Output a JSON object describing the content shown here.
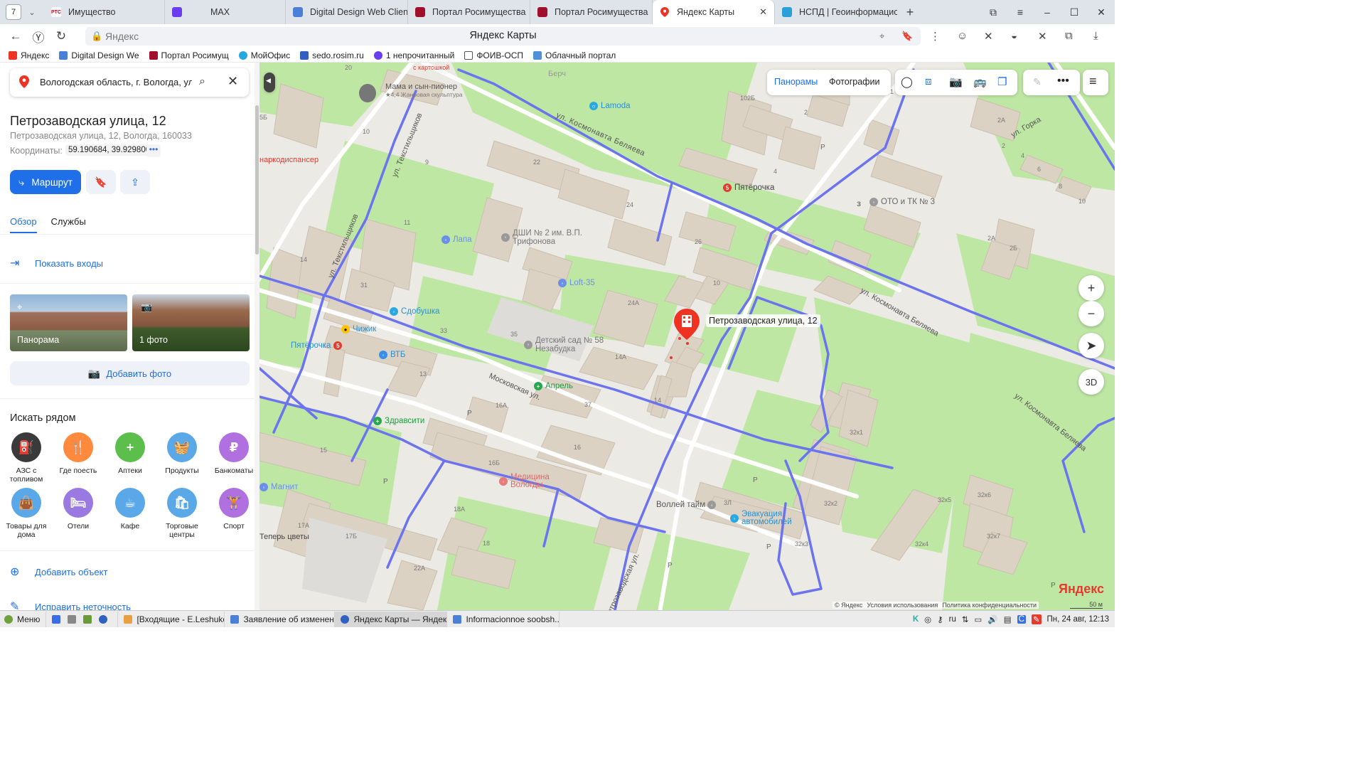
{
  "browser": {
    "tab_count": "7",
    "tabs": [
      {
        "label": "Имущество",
        "favicon_text": "РТС",
        "color": "#d0021b"
      },
      {
        "label": "MAX",
        "favicon_text": "",
        "color": "#6a3df0"
      },
      {
        "label": "Digital Design Web Client",
        "favicon_text": "",
        "color": "#4a80d8"
      },
      {
        "label": "Портал Росимущества",
        "favicon_text": "",
        "color": "#a0102c"
      },
      {
        "label": "Портал Росимущества",
        "favicon_text": "",
        "color": "#a0102c"
      },
      {
        "label": "Яндекс Карты",
        "favicon_text": "",
        "color": "#ee3323",
        "active": true
      },
      {
        "label": "НСПД | Геоинформацион",
        "favicon_text": "",
        "color": "#2aa0d8"
      }
    ],
    "close_glyph": "✕",
    "new_tab_glyph": "+",
    "address": {
      "site": "Яндекс",
      "title": "Яндекс Карты"
    },
    "bookmarks": [
      {
        "label": "Яндекс",
        "color": "#ee3323"
      },
      {
        "label": "Digital Design We",
        "color": "#4a80d8"
      },
      {
        "label": "Портал Росимущ",
        "color": "#a0102c"
      },
      {
        "label": "МойОфис",
        "color": "#28a8e0"
      },
      {
        "label": "sedo.rosim.ru",
        "color": "#3060c0"
      },
      {
        "label": "1 непрочитанный",
        "color": "#6a3df0"
      },
      {
        "label": "ФОИВ-ОСП",
        "color": "#888888"
      },
      {
        "label": "Облачный портал",
        "color": "#5090d8"
      }
    ]
  },
  "panel": {
    "search_value": "Вологодская область, г. Вологда, ул. П",
    "title": "Петрозаводская улица, 12",
    "address": "Петрозаводская улица, 12, Вологда, 160033",
    "coords_label": "Координаты:",
    "coords_value": "59.190684, 39.929800",
    "coords_more": "•••",
    "route_label": "Маршрут",
    "tabs": [
      "Обзор",
      "Службы"
    ],
    "show_entrances": "Показать входы",
    "photo_panorama": "Панорама",
    "photo_count": "1 фото",
    "add_photo": "Добавить фото",
    "nearby_title": "Искать рядом",
    "categories": [
      {
        "label": "АЗС с топливом",
        "color": "#3a3a3a",
        "icon": "fuel-icon",
        "glyph": "⛽"
      },
      {
        "label": "Где поесть",
        "color": "#ff8a3d",
        "icon": "fork-knife-icon",
        "glyph": "🍴"
      },
      {
        "label": "Аптеки",
        "color": "#5cbf4c",
        "icon": "pharmacy-cross-icon",
        "glyph": "+"
      },
      {
        "label": "Продукты",
        "color": "#5aa8e8",
        "icon": "basket-icon",
        "glyph": "🧺"
      },
      {
        "label": "Банкоматы",
        "color": "#b070e0",
        "icon": "ruble-icon",
        "glyph": "₽"
      },
      {
        "label": "Товары для дома",
        "color": "#5aa8e8",
        "icon": "bag-icon",
        "glyph": "👜"
      },
      {
        "label": "Отели",
        "color": "#9a7ae0",
        "icon": "bed-icon",
        "glyph": "🛏"
      },
      {
        "label": "Кафе",
        "color": "#5aa8e8",
        "icon": "cup-icon",
        "glyph": "☕"
      },
      {
        "label": "Торговые центры",
        "color": "#5aa8e8",
        "icon": "shopping-bag-icon",
        "glyph": "🛍"
      },
      {
        "label": "Спорт",
        "color": "#b070e0",
        "icon": "dumbbell-icon",
        "glyph": "🏋"
      }
    ],
    "add_object": "Добавить объект",
    "fix_error": "Исправить неточность"
  },
  "map": {
    "toolbar": {
      "panoramas": "Панорамы",
      "photos": "Фотографии"
    },
    "zoom_in": "+",
    "zoom_out": "−",
    "btn_3d": "3D",
    "marker_label": "Петрозаводская улица, 12",
    "streets": [
      "ул. Космонавта Беляева",
      "ул. Текстильщиков",
      "ул. Текстильщиков",
      "Московская ул.",
      "ул. Космонавта Беляева",
      "ул. Горка",
      "ул. Космонавта Беляева",
      "Петрозаводская ул."
    ],
    "pois": [
      {
        "label": "Мама и сын-пионер",
        "color": "#666666"
      },
      {
        "label": "★4,4 Жанровая скульптура",
        "color": ""
      },
      {
        "label": "Lamoda",
        "color": "#2aa8e0"
      },
      {
        "label": "Пятёрочка",
        "color": "#e63a2e"
      },
      {
        "label": "ОТО и ТК № 3",
        "color": "#888888"
      },
      {
        "label": "Лапа",
        "color": "#6a8fe8"
      },
      {
        "label": "ДШИ № 2 им. В.П. Трифонова",
        "color": "#888888"
      },
      {
        "label": "Loft-35",
        "color": "#6a8fe8"
      },
      {
        "label": "Сдобушка",
        "color": "#2aa8e0"
      },
      {
        "label": "Чижик",
        "color": "#ffc400"
      },
      {
        "label": "Пятёрочка",
        "color": "#e63a2e"
      },
      {
        "label": "ВТБ",
        "color": "#3a8ee8"
      },
      {
        "label": "Детский сад № 58 Незабудка",
        "color": "#888888"
      },
      {
        "label": "Апрель",
        "color": "#28a84c"
      },
      {
        "label": "Здравсити",
        "color": "#28a84c"
      },
      {
        "label": "Медицина Вологды",
        "color": "#e87a7a"
      },
      {
        "label": "Магнит",
        "color": "#6a8fe8"
      },
      {
        "label": "Воллей тайм",
        "color": "#888888"
      },
      {
        "label": "Эвакуация автомобилей",
        "color": "#2aa8e0"
      },
      {
        "label": "Берч",
        "color": ""
      },
      {
        "label": "наркодиспансер",
        "color": "#e63a2e"
      },
      {
        "label": "Теперь цветы",
        "color": ""
      },
      {
        "label": "с картошкой",
        "color": "#e63a2e"
      }
    ],
    "house_numbers": [
      "10",
      "9",
      "11",
      "14",
      "31",
      "33",
      "13",
      "15",
      "16А",
      "16Б",
      "16",
      "17А",
      "17Б",
      "18",
      "18А",
      "22",
      "22А",
      "24",
      "24А",
      "26",
      "14А",
      "35",
      "37",
      "14",
      "10",
      "3",
      "2",
      "4",
      "2",
      "2А",
      "4",
      "6",
      "8",
      "10",
      "2Б",
      "2А",
      "3",
      "1",
      "32к1",
      "32к2",
      "32к3",
      "32к4",
      "32к5",
      "32к6",
      "32к7",
      "3Л",
      "102Б",
      "20",
      "5Б",
      "P",
      "P",
      "P",
      "P",
      "P",
      "P",
      "P"
    ],
    "footer": {
      "copyright": "© Яндекс",
      "terms": "Условия использования",
      "privacy": "Политика конфиденциальности",
      "scale": "50 м",
      "logo": "Яндекс"
    }
  },
  "taskbar": {
    "menu": "Меню",
    "tasks": [
      {
        "label": "[Входящие - E.Leshukov...",
        "color": "#e8a040"
      },
      {
        "label": "Заявление об изменен...",
        "color": "#4a80d8"
      },
      {
        "label": "Яндекс Карты — Яндекс...",
        "color": "#3060c0",
        "active": true
      },
      {
        "label": "Informacionnoe soobsh...",
        "color": "#4a80d8"
      }
    ],
    "lang": "ru",
    "datetime": "Пн, 24 авг, 12:13"
  }
}
